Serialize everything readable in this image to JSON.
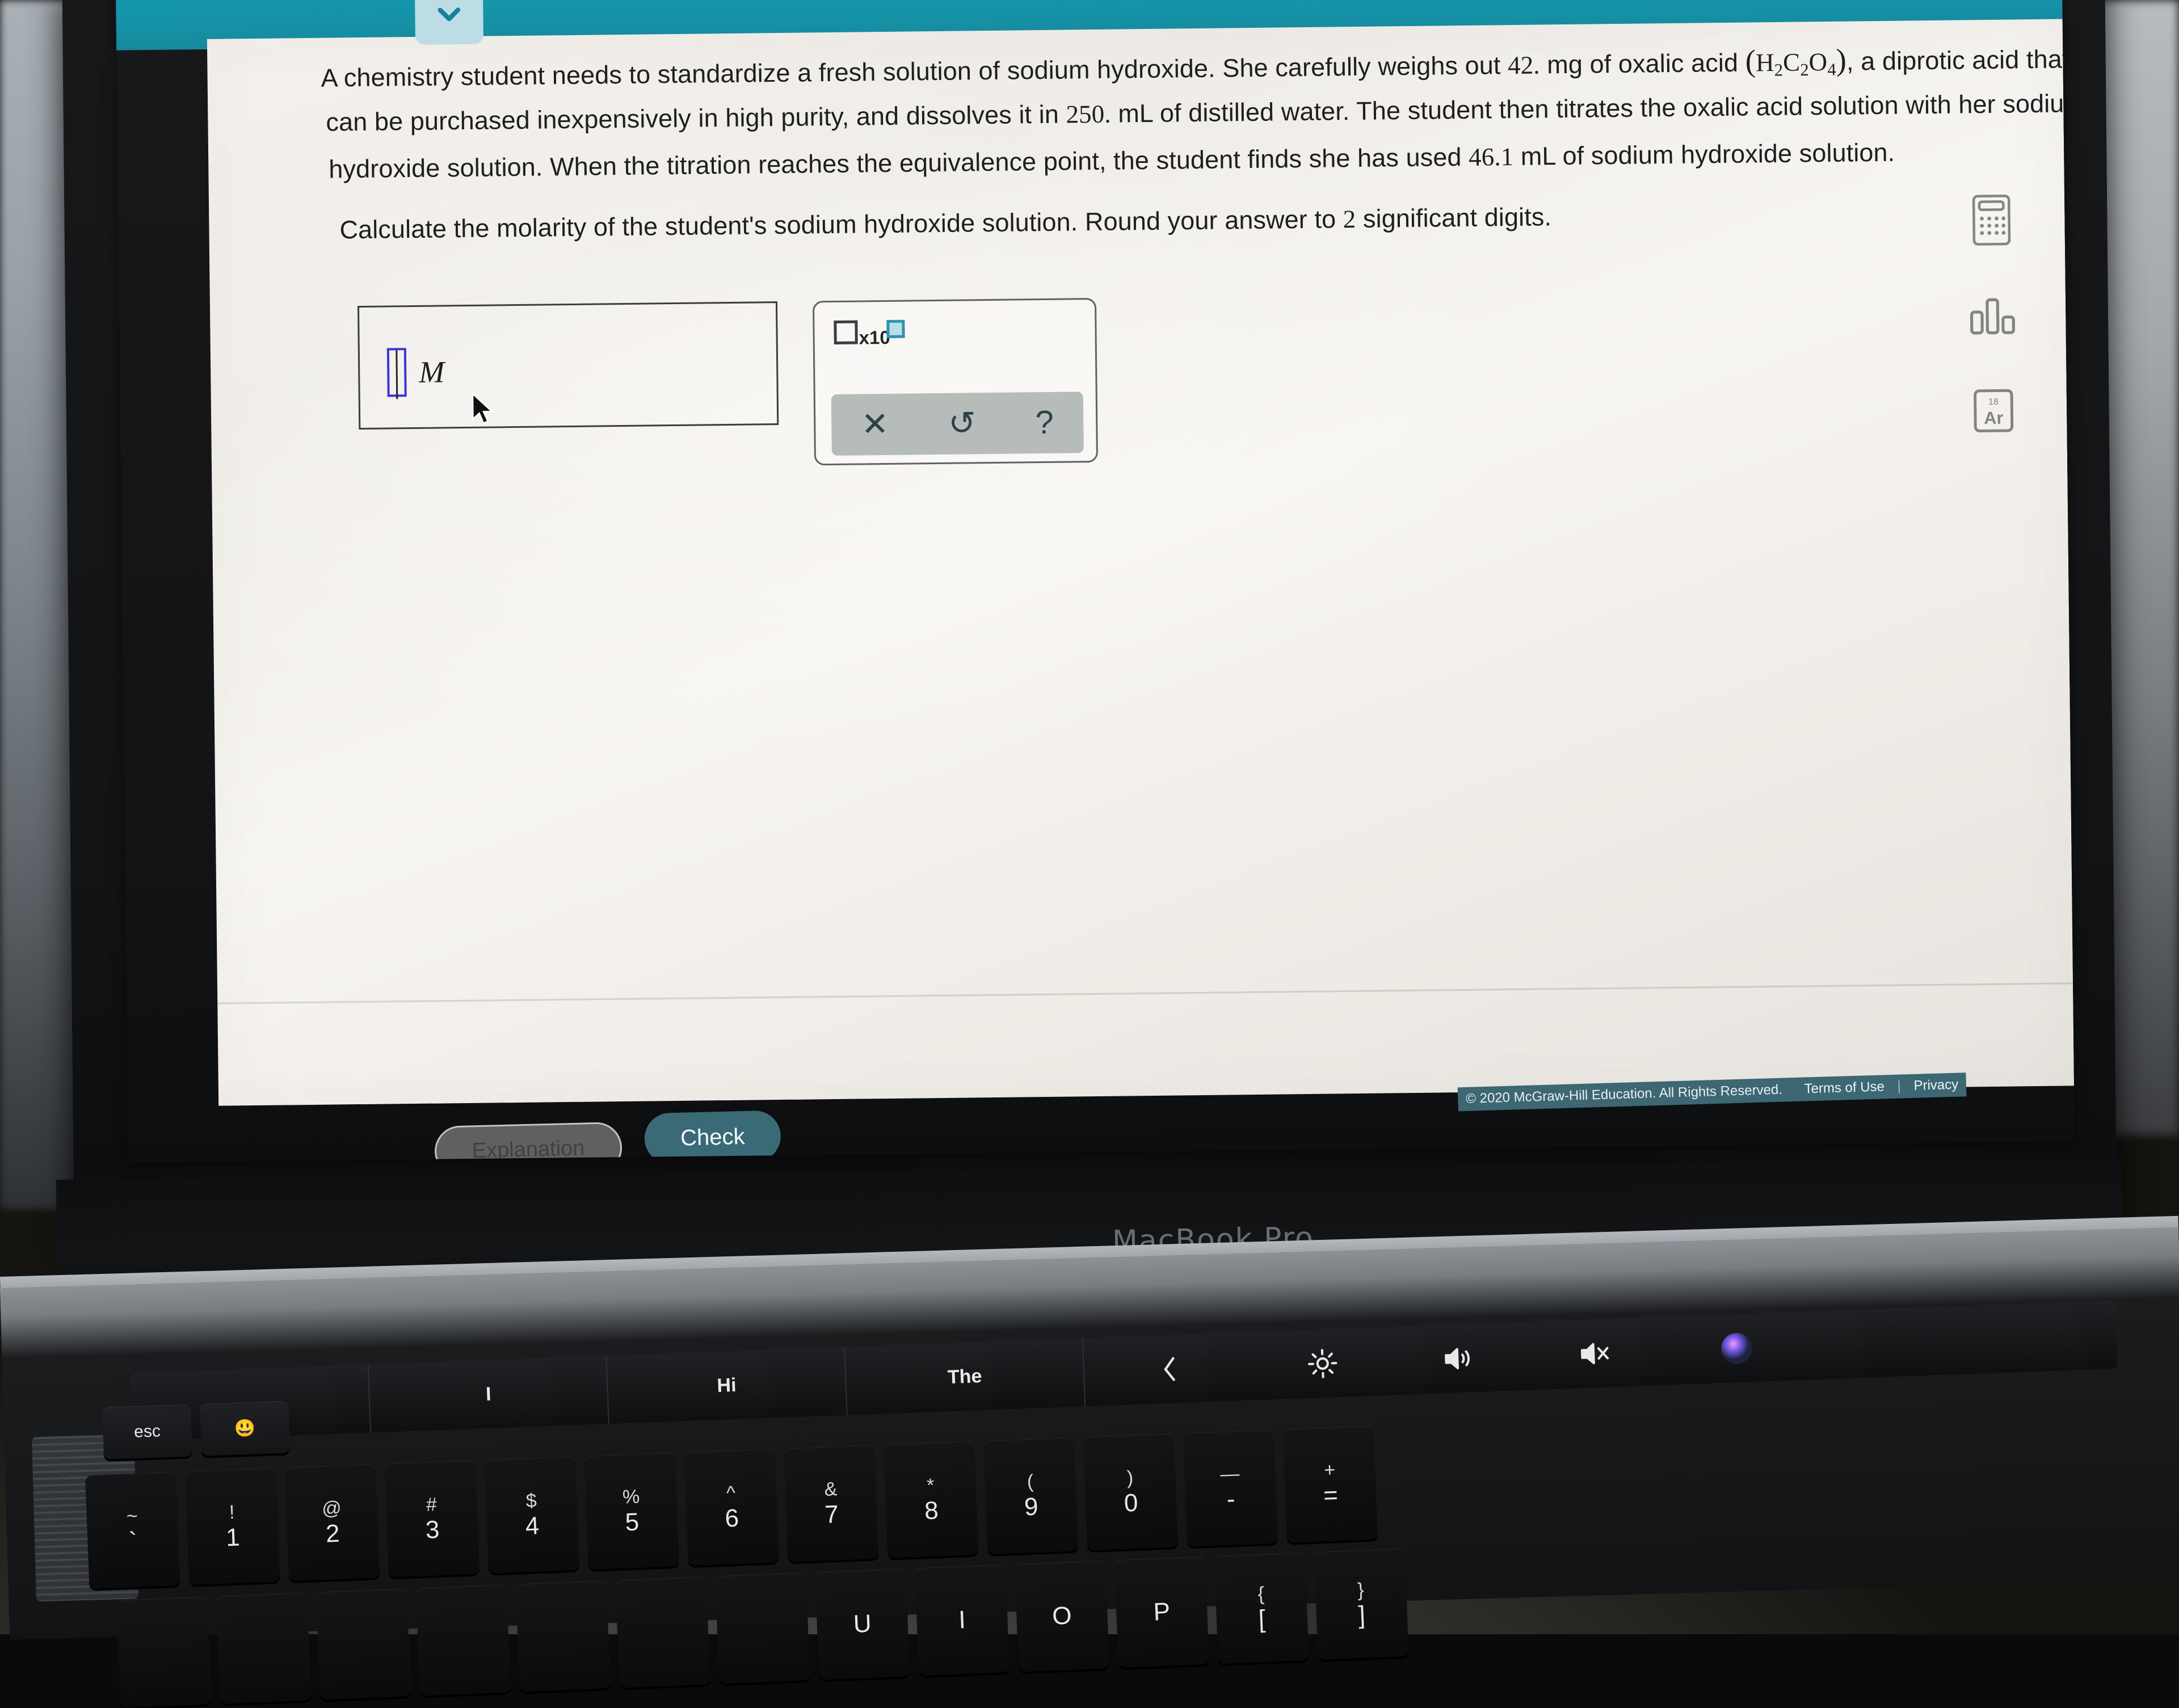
{
  "app": {
    "topbar_pill_label": "",
    "chevron_icon": "chevron-down-icon"
  },
  "question": {
    "line1_a": "A chemistry student needs to standardize a fresh solution of sodium hydroxide. She carefully weighs out ",
    "line1_value": "42.",
    "line1_b": " mg of oxalic acid ",
    "formula_open": "(",
    "formula": "H2C2O4",
    "formula_close": ")",
    "line1_c": ", a diprotic acid that",
    "line2_a": "can be purchased inexpensively in high purity, and dissolves it in ",
    "line2_value": "250.",
    "line2_b": " mL of distilled water. The student then titrates the oxalic acid solution with her sodium",
    "line3_a": "hydroxide solution. When the titration reaches the equivalence point, the student finds she has used ",
    "line3_value": "46.1",
    "line3_b": " mL of sodium hydroxide solution.",
    "line4_a": "Calculate the molarity of the student's sodium hydroxide solution. Round your answer to ",
    "line4_value": "2",
    "line4_b": " significant digits."
  },
  "answer": {
    "value": "",
    "unit": "M",
    "placeholder": ""
  },
  "palette": {
    "scientific_notation_label": "x10",
    "clear_label": "✕",
    "undo_label": "↺",
    "help_label": "?",
    "clear_icon": "clear-x-icon",
    "undo_icon": "undo-arrow-icon",
    "help_icon": "question-mark-icon"
  },
  "tools": [
    {
      "icon": "calculator-icon",
      "label": "Calculator"
    },
    {
      "icon": "bar-chart-icon",
      "label": "Data"
    },
    {
      "icon": "periodic-table-icon",
      "label": "Ar",
      "element_number": "18",
      "element_symbol": "Ar"
    }
  ],
  "footer": {
    "copyright": "© 2020 McGraw-Hill Education. All Rights Reserved.",
    "terms": "Terms of Use",
    "separator": "|",
    "privacy": "Privacy"
  },
  "actions": {
    "explanation": "Explanation",
    "check": "Check"
  },
  "hardware": {
    "brand": "MacBook Pro",
    "touchbar": {
      "suggestions": [
        "I",
        "Hi",
        "The"
      ],
      "controls": [
        "chevron-left-icon",
        "brightness-icon",
        "volume-up-icon",
        "mute-icon",
        "siri-icon"
      ]
    },
    "keys_function": [
      "esc",
      "😃"
    ],
    "keys_number": [
      {
        "up": "~",
        "lo": "`"
      },
      {
        "up": "!",
        "lo": "1"
      },
      {
        "up": "@",
        "lo": "2"
      },
      {
        "up": "#",
        "lo": "3"
      },
      {
        "up": "$",
        "lo": "4"
      },
      {
        "up": "%",
        "lo": "5"
      },
      {
        "up": "^",
        "lo": "6"
      },
      {
        "up": "&",
        "lo": "7"
      },
      {
        "up": "*",
        "lo": "8"
      },
      {
        "up": "(",
        "lo": "9"
      },
      {
        "up": ")",
        "lo": "0"
      },
      {
        "up": "—",
        "lo": "-"
      },
      {
        "up": "+",
        "lo": "="
      }
    ],
    "keys_qwerty": [
      {
        "up": "",
        "lo": ""
      },
      {
        "up": "",
        "lo": ""
      },
      {
        "up": "",
        "lo": ""
      },
      {
        "up": "",
        "lo": ""
      },
      {
        "up": "",
        "lo": ""
      },
      {
        "up": "",
        "lo": ""
      },
      {
        "up": "",
        "lo": ""
      },
      {
        "up": "",
        "lo": "U"
      },
      {
        "up": "",
        "lo": "I"
      },
      {
        "up": "",
        "lo": "O"
      },
      {
        "up": "",
        "lo": "P"
      },
      {
        "up": "{",
        "lo": "["
      },
      {
        "up": "}",
        "lo": "]"
      }
    ]
  },
  "colors": {
    "teal_topbar": "#1593a8",
    "check_button": "#3b6a77",
    "footer_bar": "#3c6773",
    "chip": "#bcdde6",
    "cursor_blue": "#3b36d8"
  }
}
